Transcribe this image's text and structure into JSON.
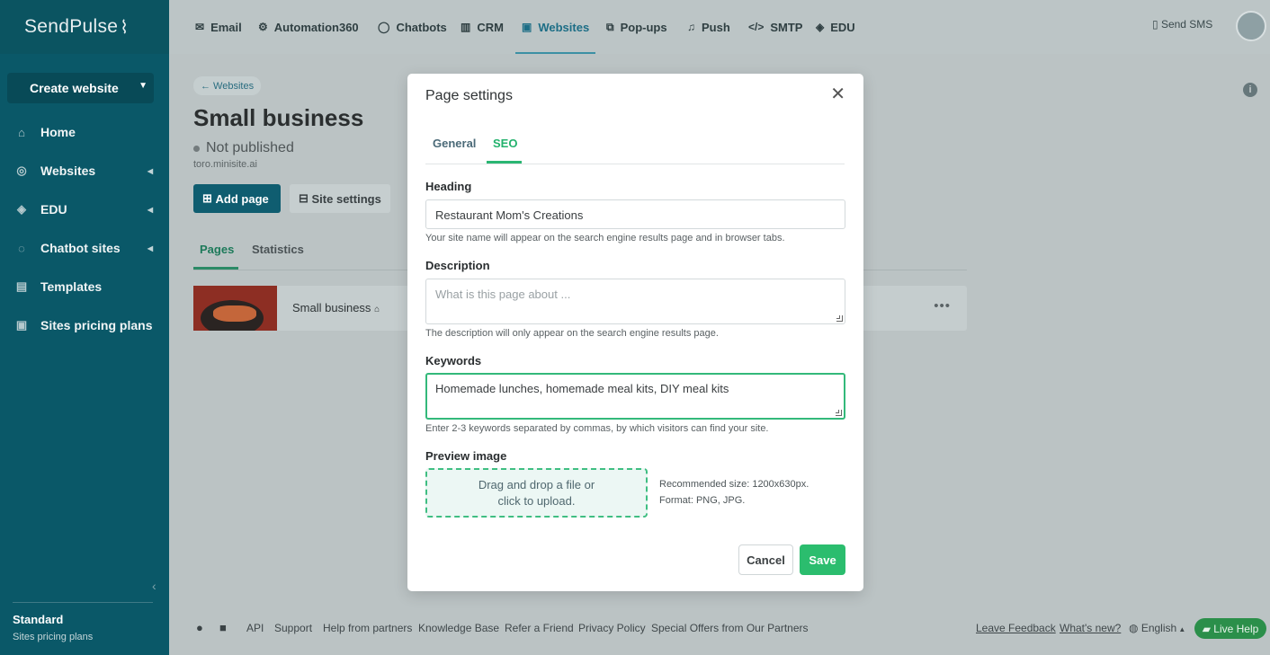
{
  "brand": "SendPulse",
  "sidebar": {
    "create_button": "Create website",
    "items": [
      {
        "label": "Home",
        "icon": "home-icon"
      },
      {
        "label": "Websites",
        "icon": "globe-icon"
      },
      {
        "label": "EDU",
        "icon": "graduation-cap-icon"
      },
      {
        "label": "Chatbot sites",
        "icon": "chat-icon"
      },
      {
        "label": "Templates",
        "icon": "templates-icon"
      },
      {
        "label": "Sites pricing plans",
        "icon": "pricing-icon"
      }
    ],
    "plan_name": "Standard",
    "plan_sub": "Sites pricing plans"
  },
  "topnav": {
    "items": [
      {
        "label": "Email",
        "icon": "mail-icon"
      },
      {
        "label": "Automation360",
        "icon": "automation-icon"
      },
      {
        "label": "Chatbots",
        "icon": "chatbot-icon"
      },
      {
        "label": "CRM",
        "icon": "crm-icon"
      },
      {
        "label": "Websites",
        "icon": "websites-icon",
        "active": true
      },
      {
        "label": "Pop-ups",
        "icon": "popups-icon"
      },
      {
        "label": "Push",
        "icon": "bell-icon"
      },
      {
        "label": "SMTP",
        "icon": "code-icon"
      },
      {
        "label": "EDU",
        "icon": "edu-icon"
      }
    ],
    "send_sms": "Send SMS"
  },
  "main": {
    "breadcrumb": "← Websites",
    "title": "Small business",
    "status": "Not published",
    "domain": "toro.minisite.ai",
    "add_page": "Add page",
    "site_settings": "Site settings",
    "tabs": [
      "Pages",
      "Statistics"
    ],
    "page_row": {
      "name": "Small business"
    }
  },
  "footer": {
    "links": [
      "API",
      "Support",
      "Help from partners",
      "Knowledge Base",
      "Refer a Friend",
      "Privacy Policy",
      "Special Offers from Our Partners"
    ],
    "leave_feedback": "Leave Feedback",
    "whats_new": "What's new?",
    "language": "English",
    "live_help": "Live Help"
  },
  "modal": {
    "title": "Page settings",
    "tabs": [
      "General",
      "SEO"
    ],
    "active_tab": "SEO",
    "heading_label": "Heading",
    "heading_value": "Restaurant Mom's Creations",
    "heading_hint": "Your site name will appear on the search engine results page and in browser tabs.",
    "description_label": "Description",
    "description_placeholder": "What is this page about ...",
    "description_hint": "The description will only appear on the search engine results page.",
    "keywords_label": "Keywords",
    "keywords_value": "Homemade lunches, homemade meal kits, DIY meal kits",
    "keywords_hint": "Enter 2-3 keywords separated by commas, by which visitors can find your site.",
    "preview_label": "Preview image",
    "dropzone_line1": "Drag and drop a file or",
    "dropzone_line2": "click to upload.",
    "recommended_size": "Recommended size: 1200x630px.",
    "format": "Format: PNG, JPG.",
    "cancel": "Cancel",
    "save": "Save"
  },
  "colors": {
    "sidebar_bg": "#0a5868",
    "accent_green": "#2bbd6e",
    "active_nav": "#1d6e86"
  }
}
